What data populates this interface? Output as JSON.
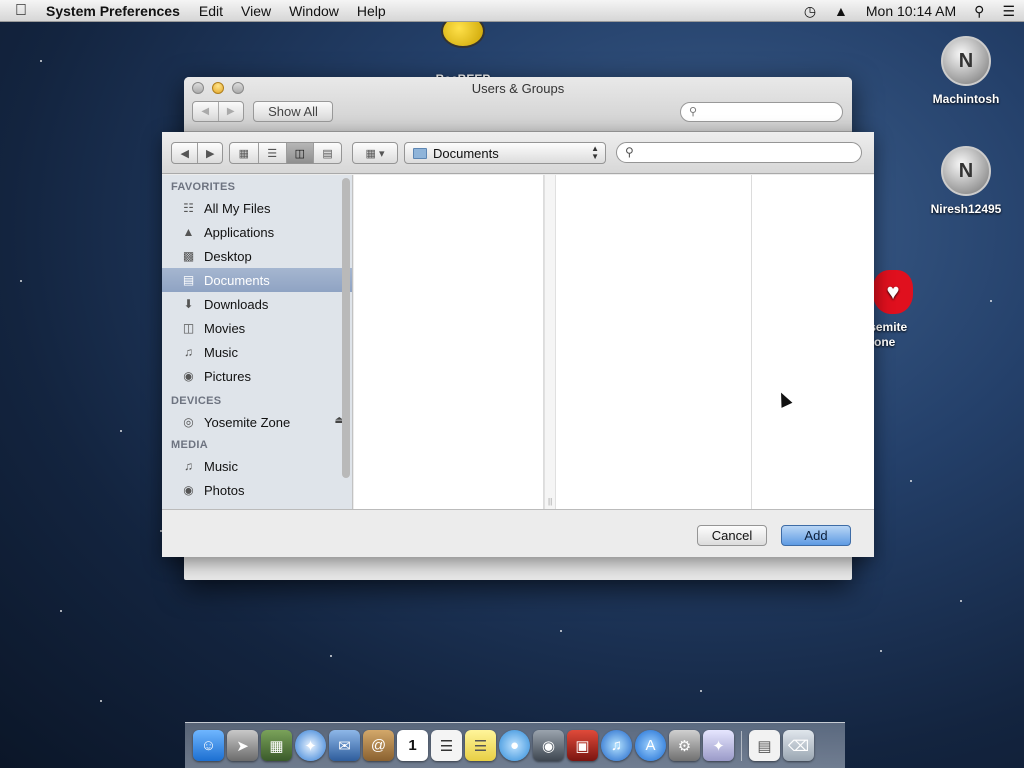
{
  "menubar": {
    "app_name": "System Preferences",
    "items": [
      "Edit",
      "View",
      "Window",
      "Help"
    ],
    "clock": "Mon 10:14 AM"
  },
  "desktop_icons": [
    {
      "label": "BeeBEEP"
    },
    {
      "label": "Machintosh"
    },
    {
      "label": "Niresh12495"
    },
    {
      "label": "Yosemite Zone"
    }
  ],
  "pref_window": {
    "title": "Users & Groups",
    "show_all_label": "Show All",
    "search_placeholder": ""
  },
  "sheet": {
    "path_selected": "Documents",
    "search_placeholder": "",
    "sidebar": {
      "sections": [
        {
          "heading": "FAVORITES",
          "items": [
            {
              "label": "All My Files",
              "icon": "all-files-icon"
            },
            {
              "label": "Applications",
              "icon": "applications-icon"
            },
            {
              "label": "Desktop",
              "icon": "desktop-icon"
            },
            {
              "label": "Documents",
              "icon": "documents-icon",
              "selected": true
            },
            {
              "label": "Downloads",
              "icon": "downloads-icon"
            },
            {
              "label": "Movies",
              "icon": "movies-icon"
            },
            {
              "label": "Music",
              "icon": "music-icon"
            },
            {
              "label": "Pictures",
              "icon": "pictures-icon"
            }
          ]
        },
        {
          "heading": "DEVICES",
          "items": [
            {
              "label": "Yosemite Zone",
              "icon": "disk-icon",
              "ejectable": true
            }
          ]
        },
        {
          "heading": "MEDIA",
          "items": [
            {
              "label": "Music",
              "icon": "music-icon"
            },
            {
              "label": "Photos",
              "icon": "photos-icon"
            }
          ]
        }
      ]
    },
    "cancel_label": "Cancel",
    "add_label": "Add"
  },
  "dock": {
    "items": [
      "finder-icon",
      "launchpad-icon",
      "mission-control-icon",
      "safari-icon",
      "mail-icon",
      "contacts-icon",
      "calendar-icon",
      "reminders-icon",
      "notes-icon",
      "messages-icon",
      "facetime-icon",
      "photo-booth-icon",
      "itunes-icon",
      "app-store-icon",
      "system-preferences-icon",
      "utility-icon",
      "document-icon",
      "trash-icon"
    ],
    "calendar_day": "1"
  }
}
